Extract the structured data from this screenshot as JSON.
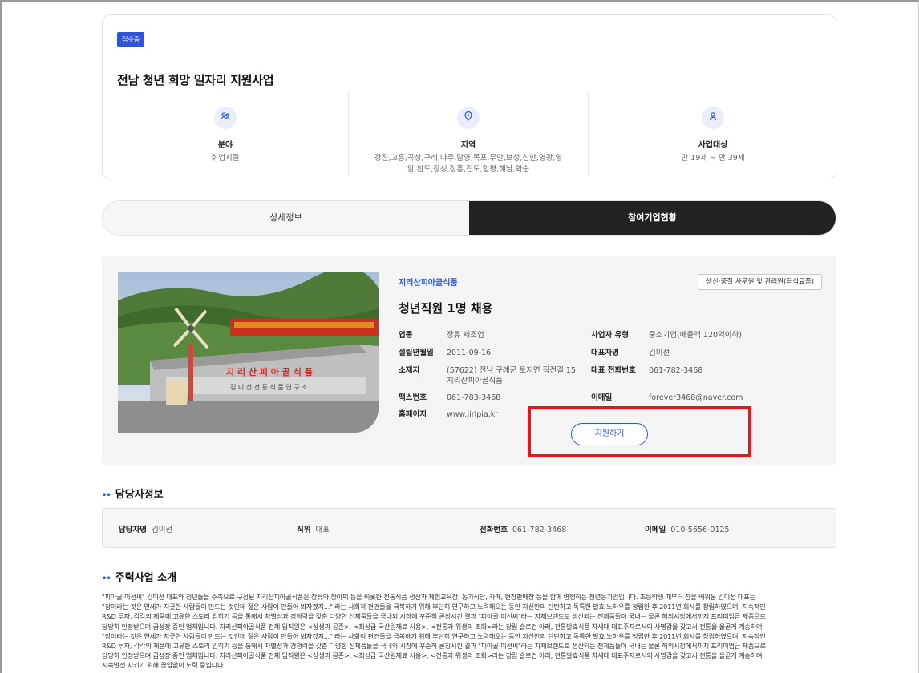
{
  "summary": {
    "status_badge": "접수중",
    "title": "전남 청년 희망 일자리 지원사업",
    "columns": [
      {
        "icon": "people-icon",
        "label": "분야",
        "value": "취업지원"
      },
      {
        "icon": "location-pin-icon",
        "label": "지역",
        "value": "강진,고흥,곡성,구례,나주,담양,목포,무안,보성,신안,영광,영암,완도,장성,장흥,진도,함평,해남,화순"
      },
      {
        "icon": "person-icon",
        "label": "사업대상",
        "value": "만 19세 ~ 만 39세"
      }
    ]
  },
  "tabs": [
    {
      "label": "상세정보",
      "active": false
    },
    {
      "label": "참여기업현황",
      "active": true
    }
  ],
  "company": {
    "name": "지리산피아골식품",
    "position_tag": "생산·품질 사무원 및 관리원(음식료품)",
    "job_title": "청년직원 1명 채용",
    "prev_arrow": "←",
    "next_arrow": "→",
    "fields": {
      "industry": {
        "label": "업종",
        "value": "장류 제조업"
      },
      "founded": {
        "label": "설립년월일",
        "value": "2011-09-16"
      },
      "address": {
        "label": "소재지",
        "value_line1": "(57622) 전남 구례군 토지면 직전길 15",
        "value_line2": "지리산피아골식품"
      },
      "fax": {
        "label": "팩스번호",
        "value": "061-783-3468"
      },
      "homepage": {
        "label": "홈페이지",
        "value": "www.jiripia.kr"
      },
      "biz_type": {
        "label": "사업자 유형",
        "value": "중소기업(매출액 120억이하)"
      },
      "ceo": {
        "label": "대표자명",
        "value": "김미선"
      },
      "ceo_phone": {
        "label": "대표 전화번호",
        "value": "061-782-3468"
      },
      "email": {
        "label": "이메일",
        "value": "forever3468@naver.com"
      }
    },
    "apply_label": "지원하기",
    "sign_text": "지 리 산 피 아 골 식 품",
    "sign_sub": "김 미 선 전 통 식 품 연 구 소"
  },
  "manager": {
    "section_title": "담당자정보",
    "name": {
      "label": "담당자명",
      "value": "김미선"
    },
    "role": {
      "label": "직위",
      "value": "대표"
    },
    "phone": {
      "label": "전화번호",
      "value": "061-782-3468"
    },
    "email": {
      "label": "이메일",
      "value": "010-5656-0125"
    }
  },
  "intro": {
    "section_title": "주력사업 소개",
    "lines": [
      "\"피아골 미선씨\" 김미선 대표와 청년들을 주축으로 구성된 지리산피아골식품은 장류와 장아찌 등을 비롯한 전통식품 생산과 체험교육장, 농가식당, 카페, 현장판매장 등을 함께 병행하는 청년농기업입니다. 초등학생 때부터 장을 배워온 김미선 대표는",
      "\"장이라는 것은 연세가 지긋한 사람들이 만드는 것인데 젊은 사람이 만들어 봐자겠지...\" 라는 사회적 편견들을 극복하기 위해 부단히 연구하고 노력해오는 동안 자신만의 탄탄하고 독특한 발효 노하우를 정립한 후 2011년 회사를 창립하였으며, 지속적인",
      "R&D 투자, 각각의 제품에 고유한 스토리 입히기 등을 통해서 차별성과 경쟁력을 갖춘 다양한 신제품들을 국내외 시장에 꾸준히 론칭시킨 결과 \"피아골 미선씨\"라는 자체브랜드로 생산되는 전제품들이 국내는 물론 해외시장에서까지 프리미엄급 제품으로",
      "당당히 인정받으며 급성장 중인 업체입니다. 지리산피아골식품 전체 임직원은 <상생과 공존>, <최상급 국산원재료 사용>, <전통과 위생의 조화>라는 창립 슬로건 아래, 전통발효식품 차세대 대표주자로서의 사명감을 갖고서 전통을 올곧게 계승하며",
      "\"장이라는 것은 연세가 지긋한 사람들이 만드는 것인데 젊은 사람이 만들어 봐자겠지...\" 라는 사회적 편견들을 극복하기 위해 부단히 연구하고 노력해오는 동안 자신만의 탄탄하고 독특한 발효 노하우를 정립한 후 2011년 회사를 창립하였으며, 지속적인",
      "R&D 투자, 각각의 제품에 고유한 스토리 입히기 등을 통해서 차별성과 경쟁력을 갖춘 다양한 신제품들을 국내외 시장에 꾸준히 론칭시킨 결과 \"피아골 미선씨\"라는 자체브랜드로 생산되는 전제품들이 국내는 물론 해외시장에서까지 프리미엄급 제품으로",
      "당당히 인정받으며 급성장 중인 업체입니다. 지리산피아골식품 전체 임직원은 <상생과 공존>, <최상급 국산원재료 사용>, <전통과 위생의 조화>라는 창립 슬로건 아래, 전통발효식품 차세대 대표주자로서의 사명감을 갖고서 전통을 올곧게 계승하며",
      "지속발전 시키기 위해 끊임없이 노력 중입니다."
    ]
  },
  "colors": {
    "accent": "#2f55d4",
    "highlight": "#e8141a",
    "dark_tab": "#222222"
  }
}
